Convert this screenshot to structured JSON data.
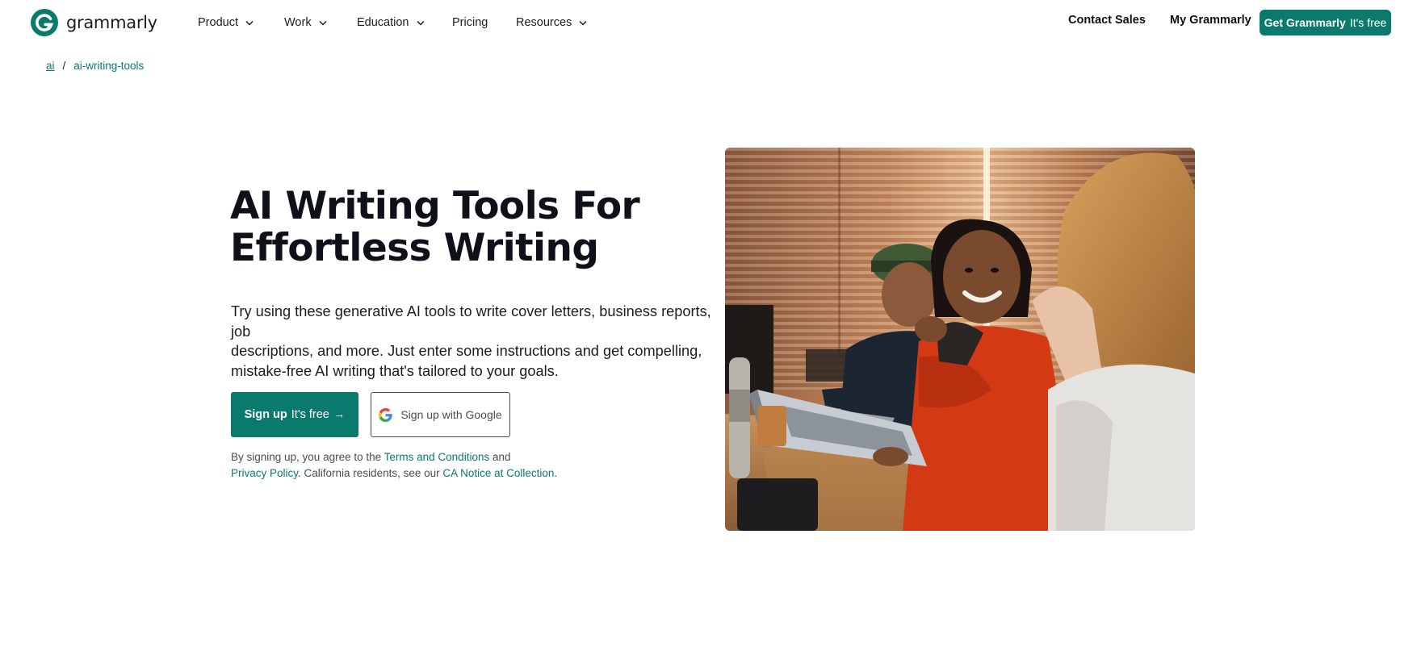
{
  "header": {
    "brand": "grammarly",
    "nav": [
      {
        "label": "Product",
        "has_dropdown": true
      },
      {
        "label": "Work",
        "has_dropdown": true
      },
      {
        "label": "Education",
        "has_dropdown": true
      },
      {
        "label": "Pricing",
        "has_dropdown": false
      },
      {
        "label": "Resources",
        "has_dropdown": true
      }
    ],
    "contact_sales": "Contact Sales",
    "my_grammarly": "My Grammarly",
    "cta_bold": "Get Grammarly",
    "cta_light": "It's free"
  },
  "breadcrumb": {
    "home": "ai",
    "separator": "/",
    "current": "ai-writing-tools"
  },
  "hero": {
    "title_line1": "AI Writing Tools For",
    "title_line2": "Effortless Writing",
    "desc_line1": "Try using these generative AI tools to write cover letters, business reports, job",
    "desc_line2": "descriptions, and more. Just enter some instructions and get compelling,",
    "desc_line3": "mistake-free AI writing that's tailored to your goals.",
    "signup_bold": "Sign up",
    "signup_light": "It's free",
    "signup_arrow": "→",
    "google_label": "Sign up with Google",
    "legal": {
      "p1": "By signing up, you agree to the ",
      "terms": "Terms and Conditions",
      "p2": " and",
      "privacy": "Privacy Policy",
      "p3": ". California residents, see our ",
      "ca_notice": "CA Notice at Collection",
      "p4": "."
    }
  },
  "icons": {
    "logo": "grammarly-g-icon",
    "chevron": "chevron-down-icon",
    "google": "google-g-icon"
  },
  "colors": {
    "brand": "#0a7a6c",
    "text": "#0e101a",
    "muted": "#4a4d57",
    "photo_sweater": "#d33a14",
    "photo_blinds": "#c78455"
  }
}
